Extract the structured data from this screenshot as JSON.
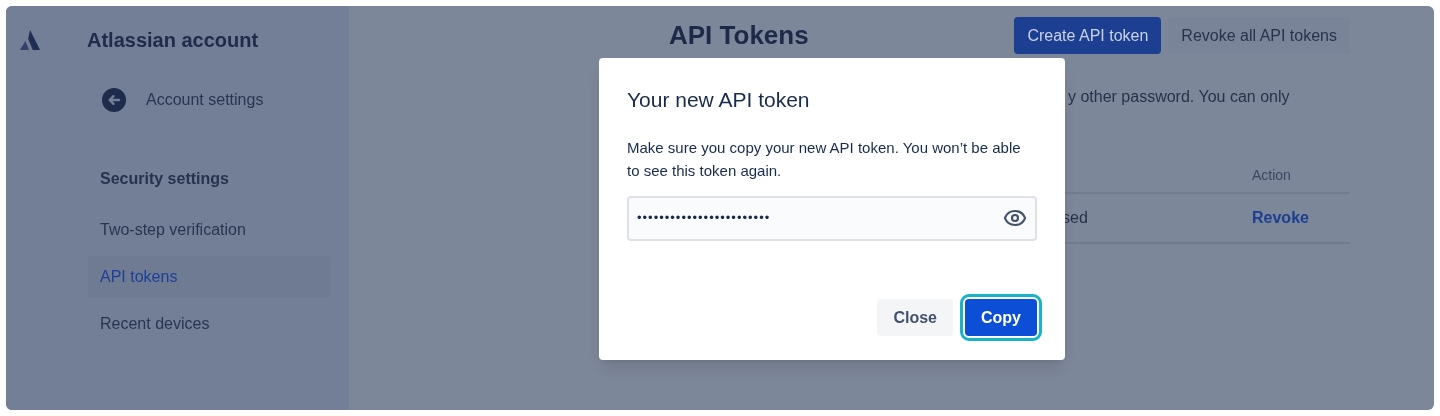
{
  "sidebar": {
    "title": "Atlassian account",
    "back_link": "Account settings",
    "section_heading": "Security settings",
    "items": [
      {
        "label": "Two-step verification",
        "selected": false
      },
      {
        "label": "API tokens",
        "selected": true
      },
      {
        "label": "Recent devices",
        "selected": false
      }
    ]
  },
  "page": {
    "title": "API Tokens",
    "buttons": [
      {
        "label": "Create API token",
        "kind": "primary"
      },
      {
        "label": "Revoke all API tokens",
        "kind": "secondary"
      }
    ],
    "description_fragment": "y other password. You can only",
    "table": {
      "columns": [
        "Action"
      ],
      "rows": [
        {
          "cell_fragment": "sed",
          "action": "Revoke"
        }
      ]
    }
  },
  "dialog": {
    "title": "Your new API token",
    "message": "Make sure you copy your new API token. You won’t be able to see this token again.",
    "token_value": "••••••••••••••••••••••••",
    "buttons": [
      {
        "label": "Close",
        "kind": "secondary"
      },
      {
        "label": "Copy",
        "kind": "primary"
      }
    ]
  }
}
